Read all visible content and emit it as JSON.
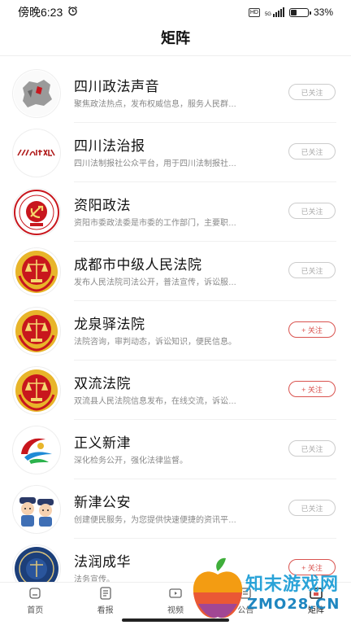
{
  "status_bar": {
    "time": "傍晚6:23",
    "network": "HD",
    "net_type": "5G",
    "battery": "33%"
  },
  "header": {
    "title": "矩阵"
  },
  "accounts": [
    {
      "name": "四川政法声音",
      "desc": "聚焦政法热点，发布权威信息，服务人民群…",
      "button": "已关注",
      "followed": true,
      "icon": "sichuan-map-logo"
    },
    {
      "name": "四川法治报",
      "desc": "四川法制报社公众平台，用于四川法制报社…",
      "button": "已关注",
      "followed": true,
      "icon": "newspaper-logo"
    },
    {
      "name": "资阳政法",
      "desc": "资阳市委政法委是市委的工作部门，主要职…",
      "button": "已关注",
      "followed": true,
      "icon": "party-emblem-logo"
    },
    {
      "name": "成都市中级人民法院",
      "desc": "发布人民法院司法公开，普法宣传，诉讼服…",
      "button": "已关注",
      "followed": true,
      "icon": "court-emblem-logo"
    },
    {
      "name": "龙泉驿法院",
      "desc": "法院咨询，审判动态，诉讼知识，便民信息。",
      "button": "+ 关注",
      "followed": false,
      "icon": "court-emblem-logo"
    },
    {
      "name": "双流法院",
      "desc": "双流县人民法院信息发布，在线交流，诉讼…",
      "button": "+ 关注",
      "followed": false,
      "icon": "court-emblem-logo"
    },
    {
      "name": "正义新津",
      "desc": "深化检务公开，强化法律监督。",
      "button": "已关注",
      "followed": true,
      "icon": "procuratorate-logo"
    },
    {
      "name": "新津公安",
      "desc": "创建便民服务，为您提供快速便捷的资讯平…",
      "button": "已关注",
      "followed": true,
      "icon": "police-cartoon-logo"
    },
    {
      "name": "法润成华",
      "desc": "法务宣传。",
      "button": "+ 关注",
      "followed": false,
      "icon": "court-seal-logo"
    }
  ],
  "tabbar": [
    {
      "label": "首页",
      "icon": "home-icon"
    },
    {
      "label": "看报",
      "icon": "newspaper-icon"
    },
    {
      "label": "视频",
      "icon": "video-icon"
    },
    {
      "label": "公告",
      "icon": "notice-icon"
    },
    {
      "label": "矩阵",
      "icon": "matrix-icon"
    }
  ],
  "watermark": {
    "line1": "知末游戏网",
    "line2": "ZMO28.CN"
  },
  "colors": {
    "follow_red": "#d9534f",
    "court_red": "#c8161d",
    "gold": "#e8b52a"
  }
}
